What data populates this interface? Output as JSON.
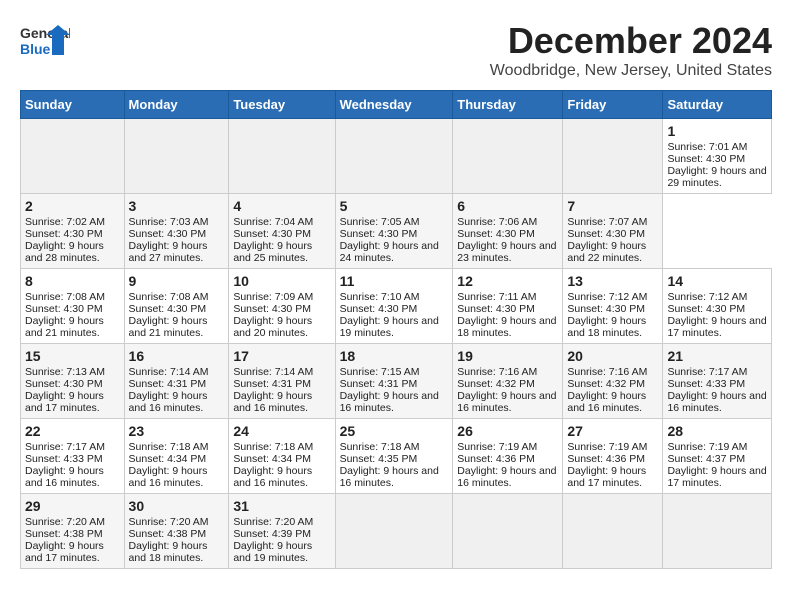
{
  "header": {
    "logo_general": "General",
    "logo_blue": "Blue",
    "title": "December 2024",
    "subtitle": "Woodbridge, New Jersey, United States"
  },
  "calendar": {
    "weekdays": [
      "Sunday",
      "Monday",
      "Tuesday",
      "Wednesday",
      "Thursday",
      "Friday",
      "Saturday"
    ],
    "weeks": [
      [
        null,
        null,
        null,
        null,
        null,
        null,
        {
          "day": "1",
          "sunrise": "Sunrise: 7:01 AM",
          "sunset": "Sunset: 4:30 PM",
          "daylight": "Daylight: 9 hours and 29 minutes."
        }
      ],
      [
        {
          "day": "2",
          "sunrise": "Sunrise: 7:02 AM",
          "sunset": "Sunset: 4:30 PM",
          "daylight": "Daylight: 9 hours and 28 minutes."
        },
        {
          "day": "3",
          "sunrise": "Sunrise: 7:03 AM",
          "sunset": "Sunset: 4:30 PM",
          "daylight": "Daylight: 9 hours and 27 minutes."
        },
        {
          "day": "4",
          "sunrise": "Sunrise: 7:04 AM",
          "sunset": "Sunset: 4:30 PM",
          "daylight": "Daylight: 9 hours and 25 minutes."
        },
        {
          "day": "5",
          "sunrise": "Sunrise: 7:05 AM",
          "sunset": "Sunset: 4:30 PM",
          "daylight": "Daylight: 9 hours and 24 minutes."
        },
        {
          "day": "6",
          "sunrise": "Sunrise: 7:06 AM",
          "sunset": "Sunset: 4:30 PM",
          "daylight": "Daylight: 9 hours and 23 minutes."
        },
        {
          "day": "7",
          "sunrise": "Sunrise: 7:07 AM",
          "sunset": "Sunset: 4:30 PM",
          "daylight": "Daylight: 9 hours and 22 minutes."
        }
      ],
      [
        {
          "day": "8",
          "sunrise": "Sunrise: 7:08 AM",
          "sunset": "Sunset: 4:30 PM",
          "daylight": "Daylight: 9 hours and 21 minutes."
        },
        {
          "day": "9",
          "sunrise": "Sunrise: 7:08 AM",
          "sunset": "Sunset: 4:30 PM",
          "daylight": "Daylight: 9 hours and 21 minutes."
        },
        {
          "day": "10",
          "sunrise": "Sunrise: 7:09 AM",
          "sunset": "Sunset: 4:30 PM",
          "daylight": "Daylight: 9 hours and 20 minutes."
        },
        {
          "day": "11",
          "sunrise": "Sunrise: 7:10 AM",
          "sunset": "Sunset: 4:30 PM",
          "daylight": "Daylight: 9 hours and 19 minutes."
        },
        {
          "day": "12",
          "sunrise": "Sunrise: 7:11 AM",
          "sunset": "Sunset: 4:30 PM",
          "daylight": "Daylight: 9 hours and 18 minutes."
        },
        {
          "day": "13",
          "sunrise": "Sunrise: 7:12 AM",
          "sunset": "Sunset: 4:30 PM",
          "daylight": "Daylight: 9 hours and 18 minutes."
        },
        {
          "day": "14",
          "sunrise": "Sunrise: 7:12 AM",
          "sunset": "Sunset: 4:30 PM",
          "daylight": "Daylight: 9 hours and 17 minutes."
        }
      ],
      [
        {
          "day": "15",
          "sunrise": "Sunrise: 7:13 AM",
          "sunset": "Sunset: 4:30 PM",
          "daylight": "Daylight: 9 hours and 17 minutes."
        },
        {
          "day": "16",
          "sunrise": "Sunrise: 7:14 AM",
          "sunset": "Sunset: 4:31 PM",
          "daylight": "Daylight: 9 hours and 16 minutes."
        },
        {
          "day": "17",
          "sunrise": "Sunrise: 7:14 AM",
          "sunset": "Sunset: 4:31 PM",
          "daylight": "Daylight: 9 hours and 16 minutes."
        },
        {
          "day": "18",
          "sunrise": "Sunrise: 7:15 AM",
          "sunset": "Sunset: 4:31 PM",
          "daylight": "Daylight: 9 hours and 16 minutes."
        },
        {
          "day": "19",
          "sunrise": "Sunrise: 7:16 AM",
          "sunset": "Sunset: 4:32 PM",
          "daylight": "Daylight: 9 hours and 16 minutes."
        },
        {
          "day": "20",
          "sunrise": "Sunrise: 7:16 AM",
          "sunset": "Sunset: 4:32 PM",
          "daylight": "Daylight: 9 hours and 16 minutes."
        },
        {
          "day": "21",
          "sunrise": "Sunrise: 7:17 AM",
          "sunset": "Sunset: 4:33 PM",
          "daylight": "Daylight: 9 hours and 16 minutes."
        }
      ],
      [
        {
          "day": "22",
          "sunrise": "Sunrise: 7:17 AM",
          "sunset": "Sunset: 4:33 PM",
          "daylight": "Daylight: 9 hours and 16 minutes."
        },
        {
          "day": "23",
          "sunrise": "Sunrise: 7:18 AM",
          "sunset": "Sunset: 4:34 PM",
          "daylight": "Daylight: 9 hours and 16 minutes."
        },
        {
          "day": "24",
          "sunrise": "Sunrise: 7:18 AM",
          "sunset": "Sunset: 4:34 PM",
          "daylight": "Daylight: 9 hours and 16 minutes."
        },
        {
          "day": "25",
          "sunrise": "Sunrise: 7:18 AM",
          "sunset": "Sunset: 4:35 PM",
          "daylight": "Daylight: 9 hours and 16 minutes."
        },
        {
          "day": "26",
          "sunrise": "Sunrise: 7:19 AM",
          "sunset": "Sunset: 4:36 PM",
          "daylight": "Daylight: 9 hours and 16 minutes."
        },
        {
          "day": "27",
          "sunrise": "Sunrise: 7:19 AM",
          "sunset": "Sunset: 4:36 PM",
          "daylight": "Daylight: 9 hours and 17 minutes."
        },
        {
          "day": "28",
          "sunrise": "Sunrise: 7:19 AM",
          "sunset": "Sunset: 4:37 PM",
          "daylight": "Daylight: 9 hours and 17 minutes."
        }
      ],
      [
        {
          "day": "29",
          "sunrise": "Sunrise: 7:20 AM",
          "sunset": "Sunset: 4:38 PM",
          "daylight": "Daylight: 9 hours and 17 minutes."
        },
        {
          "day": "30",
          "sunrise": "Sunrise: 7:20 AM",
          "sunset": "Sunset: 4:38 PM",
          "daylight": "Daylight: 9 hours and 18 minutes."
        },
        {
          "day": "31",
          "sunrise": "Sunrise: 7:20 AM",
          "sunset": "Sunset: 4:39 PM",
          "daylight": "Daylight: 9 hours and 19 minutes."
        },
        null,
        null,
        null,
        null
      ]
    ]
  }
}
